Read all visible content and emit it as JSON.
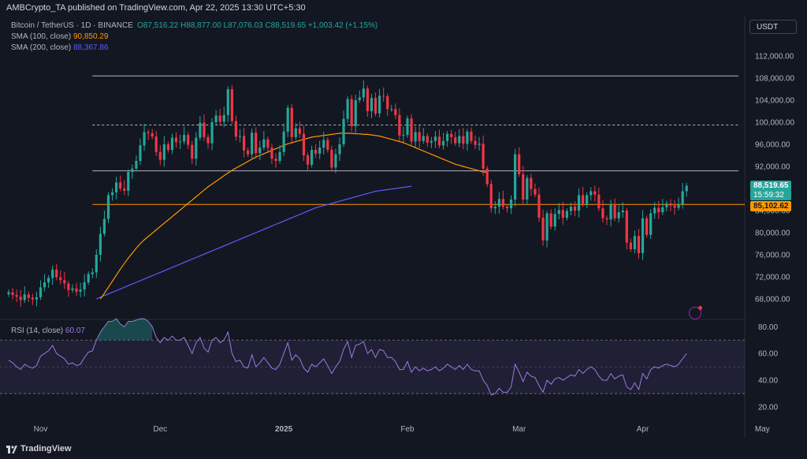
{
  "header": {
    "published": "AMBCrypto_TA published on TradingView.com, Apr 22, 2025 13:30 UTC+5:30"
  },
  "legend": {
    "title": "Bitcoin / TetherUS · 1D · BINANCE",
    "ohlc": "O87,516.22 H88,877.00 L87,076.03 C88,519.65 +1,003.42 (+1.15%)",
    "sma100_label": "SMA (100, close)",
    "sma100_value": "90,850.29",
    "sma200_label": "SMA (200, close)",
    "sma200_value": "88,367.86",
    "rsi_label": "RSI (14, close)",
    "rsi_value": "60.07"
  },
  "currency_button": "USDT",
  "price_badges": {
    "last_price": "88,519.65",
    "countdown": "15:59:32",
    "level": "85,102.62"
  },
  "footer": {
    "brand": "TradingView"
  },
  "colors": {
    "background": "#131722",
    "up": "#26a69a",
    "down": "#f23645",
    "sma100": "#ff9800",
    "sma200": "#5c5cff",
    "rsi": "#9c7be0",
    "level_line": "#ff9800",
    "hlines": "#b2b5be"
  },
  "chart_data": {
    "type": "candlestick",
    "symbol": "BTCUSDT",
    "timeframe": "1D",
    "y_ticks": [
      68000,
      72000,
      76000,
      80000,
      84000,
      88000,
      92000,
      96000,
      100000,
      104000,
      108000,
      112000
    ],
    "y_tick_labels": [
      "68,000.00",
      "72,000.00",
      "76,000.00",
      "80,000.00",
      "84,000.00",
      "88,000.00",
      "92,000.00",
      "96,000.00",
      "100,000.00",
      "104,000.00",
      "108,000.00",
      "112,000.00"
    ],
    "x_labels": [
      {
        "label": "Nov",
        "index": 8
      },
      {
        "label": "Dec",
        "index": 38
      },
      {
        "label": "2025",
        "index": 69
      },
      {
        "label": "Feb",
        "index": 100
      },
      {
        "label": "Mar",
        "index": 128
      },
      {
        "label": "Apr",
        "index": 159
      },
      {
        "label": "May",
        "index": 189
      }
    ],
    "close": [
      69200,
      68700,
      68400,
      67800,
      68800,
      68200,
      67900,
      68300,
      70100,
      71000,
      71800,
      73300,
      71900,
      71400,
      70800,
      69600,
      69900,
      69300,
      69700,
      71000,
      72500,
      72800,
      76000,
      79800,
      82500,
      86800,
      87300,
      89100,
      88000,
      87600,
      91000,
      91600,
      93000,
      95800,
      98200,
      98000,
      97400,
      94600,
      93200,
      96000,
      95000,
      97200,
      96400,
      96500,
      97700,
      95900,
      93400,
      97200,
      99900,
      97300,
      96200,
      100000,
      101200,
      100100,
      101300,
      106000,
      100200,
      97400,
      97500,
      94900,
      94200,
      98100,
      94400,
      95400,
      96900,
      95400,
      93400,
      93000,
      94600,
      98300,
      102600,
      97300,
      98900,
      97900,
      94000,
      92300,
      95000,
      94300,
      95400,
      96800,
      95000,
      91800,
      94200,
      96000,
      100600,
      104200,
      99300,
      104000,
      104500,
      106100,
      102000,
      104400,
      101600,
      104800,
      104700,
      102400,
      102400,
      101300,
      97600,
      97700,
      100700,
      96500,
      98200,
      96600,
      97500,
      96300,
      96600,
      97400,
      95800,
      96600,
      97900,
      97300,
      96200,
      97500,
      96100,
      98300,
      96600,
      95900,
      96100,
      91600,
      88800,
      84400,
      84700,
      86100,
      84700,
      84400,
      86000,
      94200,
      90600,
      86000,
      89900,
      87900,
      86900,
      82700,
      78600,
      83500,
      81100,
      83400,
      84100,
      82700,
      83900,
      84700,
      84000,
      86800,
      85200,
      86800,
      87500,
      86900,
      84400,
      82600,
      82400,
      85200,
      82600,
      83700,
      84000,
      78200,
      77000,
      79400,
      76300,
      82600,
      79600,
      83500,
      84500,
      83700,
      84600,
      85300,
      84900,
      84500,
      85100,
      87500,
      88500
    ],
    "sma100": [
      null,
      null,
      null,
      null,
      null,
      null,
      null,
      null,
      null,
      null,
      null,
      null,
      null,
      null,
      null,
      null,
      null,
      null,
      null,
      null,
      null,
      null,
      null,
      68000,
      69000,
      70100,
      71200,
      72300,
      73400,
      74400,
      75400,
      76300,
      77200,
      78000,
      78700,
      79300,
      79900,
      80500,
      81100,
      81700,
      82300,
      82900,
      83500,
      84100,
      84700,
      85300,
      85900,
      86500,
      87100,
      87700,
      88300,
      88800,
      89300,
      89800,
      90300,
      90800,
      91300,
      91700,
      92100,
      92500,
      92900,
      93300,
      93700,
      94000,
      94300,
      94600,
      94900,
      95200,
      95500,
      95800,
      96100,
      96300,
      96500,
      96700,
      96900,
      97100,
      97300,
      97400,
      97500,
      97600,
      97700,
      97800,
      97900,
      98000,
      98000,
      98000,
      98000,
      97900,
      97900,
      97800,
      97800,
      97700,
      97600,
      97500,
      97300,
      97100,
      96900,
      96700,
      96500,
      96300,
      96000,
      95700,
      95400,
      95100,
      94800,
      94500,
      94200,
      93900,
      93600,
      93300,
      93000,
      92700,
      92400,
      92200,
      92000,
      91800,
      91600,
      91400,
      91200,
      91000,
      90900
    ],
    "sma200_start_index": 22,
    "sma200": [
      68000,
      68300,
      68600,
      68900,
      69200,
      69500,
      69800,
      70100,
      70400,
      70700,
      71000,
      71300,
      71600,
      71900,
      72200,
      72500,
      72800,
      73100,
      73400,
      73700,
      74000,
      74300,
      74600,
      74900,
      75200,
      75500,
      75800,
      76100,
      76400,
      76700,
      77000,
      77300,
      77600,
      77900,
      78200,
      78500,
      78800,
      79100,
      79400,
      79700,
      80000,
      80300,
      80600,
      80900,
      81200,
      81500,
      81800,
      82100,
      82400,
      82700,
      83000,
      83300,
      83600,
      83900,
      84200,
      84500,
      84700,
      84900,
      85100,
      85300,
      85500,
      85700,
      85900,
      86100,
      86300,
      86500,
      86700,
      86900,
      87100,
      87300,
      87500,
      87600,
      87700,
      87800,
      87900,
      88000,
      88100,
      88200,
      88300,
      88400
    ],
    "rsi": [
      55,
      53,
      50,
      48,
      52,
      50,
      49,
      51,
      58,
      60,
      62,
      66,
      60,
      58,
      56,
      52,
      53,
      51,
      52,
      57,
      61,
      62,
      70,
      76,
      80,
      84,
      84,
      86,
      82,
      80,
      84,
      84,
      85,
      86,
      86,
      84,
      80,
      72,
      68,
      72,
      70,
      73,
      70,
      70,
      72,
      66,
      60,
      68,
      72,
      64,
      61,
      70,
      72,
      68,
      70,
      76,
      60,
      54,
      55,
      50,
      49,
      59,
      50,
      53,
      57,
      53,
      49,
      48,
      52,
      60,
      68,
      55,
      59,
      56,
      49,
      46,
      52,
      50,
      53,
      56,
      51,
      45,
      50,
      54,
      63,
      69,
      57,
      66,
      67,
      69,
      60,
      63,
      57,
      63,
      62,
      57,
      57,
      54,
      48,
      48,
      54,
      46,
      50,
      47,
      49,
      47,
      48,
      50,
      47,
      49,
      52,
      50,
      48,
      51,
      48,
      52,
      48,
      47,
      47,
      40,
      36,
      29,
      30,
      34,
      31,
      31,
      35,
      52,
      46,
      39,
      46,
      43,
      42,
      36,
      31,
      40,
      37,
      41,
      42,
      40,
      42,
      44,
      43,
      48,
      45,
      48,
      50,
      48,
      43,
      40,
      40,
      45,
      41,
      43,
      44,
      35,
      33,
      38,
      33,
      45,
      41,
      48,
      50,
      49,
      51,
      52,
      51,
      50,
      52,
      56,
      60
    ],
    "rsi_ticks": [
      20,
      40,
      60,
      80
    ],
    "rsi_tick_labels": [
      "20.00",
      "40.00",
      "60.00",
      "80.00"
    ],
    "rsi_band": [
      30,
      70
    ],
    "horizontal_levels": [
      108400,
      99500,
      91200
    ],
    "support_level": 85102.62
  }
}
